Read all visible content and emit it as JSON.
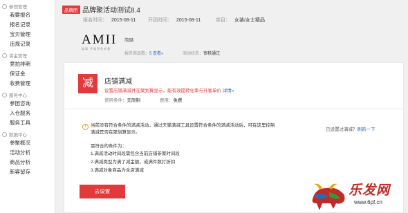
{
  "sidebar": {
    "groups": [
      {
        "title": "参团管理",
        "items": [
          "我要报名",
          "报名记录",
          "宝贝管理",
          "违规记录"
        ]
      },
      {
        "title": "资金管理",
        "items": [
          "竞拍排期",
          "保证金",
          "收费管理"
        ]
      },
      {
        "title": "服务中心",
        "items": [
          "参团咨询",
          "入仓服务",
          "服务工具"
        ]
      },
      {
        "title": "数据中心",
        "items": [
          "参聚概况",
          "活动分析",
          "商品分析",
          "新客留存"
        ]
      }
    ]
  },
  "header": {
    "tag": "品牌团",
    "title": "品牌聚活动测试8.4",
    "signup_label": "报名时间：",
    "signup_value": "2015-08-11",
    "open_label": "开团时间：",
    "open_value": "2015-08-11",
    "category_label": "类目：",
    "category_value": "女装/女士精品",
    "brand": {
      "logo_main": "AMII",
      "logo_sub": "极简  不如声色的我",
      "name": "简璐",
      "count_label": "报名商品数：",
      "count_value": "5",
      "count_link": "查看»",
      "status_label": "活动状态：",
      "status_value": "审核通过"
    }
  },
  "promo": {
    "icon_char": "减",
    "title": "店铺满减",
    "tip": "设置店铺满减并在聚划算显示，能有效提转化率与升客单价",
    "tip_link": "详情»",
    "cond_label": "使用条件：",
    "cond_value": "无限制",
    "fee_label": "费用：",
    "fee_value": "免费"
  },
  "notice": {
    "text": "当前没有符合条件的满减活动，通过天猫满减工具设置符合条件的满减活动后，可在这里控制满减是否在聚划算显示。",
    "cond_title": "需符合的条件为：",
    "conditions": [
      "1.满减活动时间段需包含当前店铺参聚时间段",
      "2.满减类型为满了减金额，或满件数打折扣",
      "3.满减对象商品为全店满减"
    ],
    "button": "去设置"
  },
  "right_status": {
    "text": "已设置过满减？",
    "link": "刷新一下"
  },
  "watermark": {
    "text": "乐发网",
    "url": "www.6pf.cn"
  },
  "colors": {
    "accent": "#e4393c",
    "link": "#2f6ebc",
    "warn": "#f39800"
  }
}
